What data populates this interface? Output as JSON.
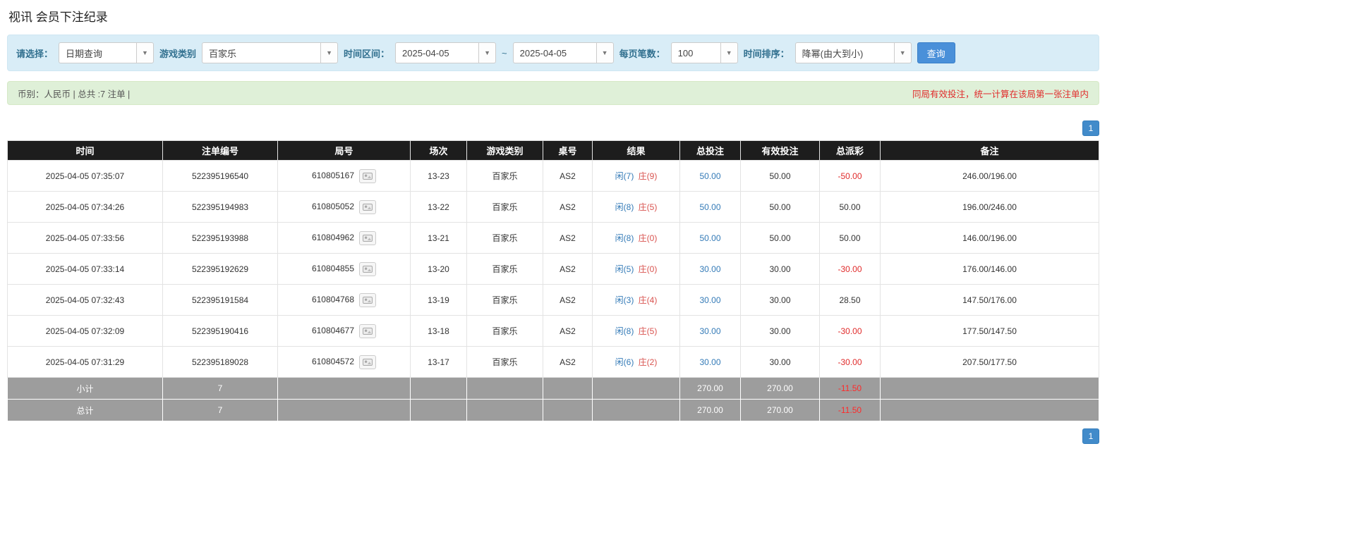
{
  "page": {
    "title": "视讯 会员下注纪录"
  },
  "filters": {
    "select_label": "请选择：",
    "select_value": "日期查询",
    "game_type_label": "游戏类别",
    "game_type_value": "百家乐",
    "time_range_label": "时间区间：",
    "date_from": "2025-04-05",
    "range_separator": "~",
    "date_to": "2025-04-05",
    "page_size_label": "每页笔数：",
    "page_size_value": "100",
    "sort_label": "时间排序：",
    "sort_value": "降幂(由大到小)",
    "search_button": "查询"
  },
  "summary": {
    "left": "币别：人民币 | 总共 :7 注单 |",
    "right": "同局有效投注，统一计算在该局第一张注单内"
  },
  "pagination": {
    "page": "1"
  },
  "table": {
    "headers": [
      "时间",
      "注单编号",
      "局号",
      "场次",
      "游戏类别",
      "桌号",
      "结果",
      "总投注",
      "有效投注",
      "总派彩",
      "备注"
    ],
    "rows": [
      {
        "time": "2025-04-05 07:35:07",
        "bet_id": "522395196540",
        "round_id": "610805167",
        "session": "13-23",
        "game": "百家乐",
        "table_no": "AS2",
        "result_player": "闲(7)",
        "result_banker": "庄(9)",
        "total_bet": "50.00",
        "valid_bet": "50.00",
        "payout": "-50.00",
        "remark": "246.00/196.00"
      },
      {
        "time": "2025-04-05 07:34:26",
        "bet_id": "522395194983",
        "round_id": "610805052",
        "session": "13-22",
        "game": "百家乐",
        "table_no": "AS2",
        "result_player": "闲(8)",
        "result_banker": "庄(5)",
        "total_bet": "50.00",
        "valid_bet": "50.00",
        "payout": "50.00",
        "remark": "196.00/246.00"
      },
      {
        "time": "2025-04-05 07:33:56",
        "bet_id": "522395193988",
        "round_id": "610804962",
        "session": "13-21",
        "game": "百家乐",
        "table_no": "AS2",
        "result_player": "闲(8)",
        "result_banker": "庄(0)",
        "total_bet": "50.00",
        "valid_bet": "50.00",
        "payout": "50.00",
        "remark": "146.00/196.00"
      },
      {
        "time": "2025-04-05 07:33:14",
        "bet_id": "522395192629",
        "round_id": "610804855",
        "session": "13-20",
        "game": "百家乐",
        "table_no": "AS2",
        "result_player": "闲(5)",
        "result_banker": "庄(0)",
        "total_bet": "30.00",
        "valid_bet": "30.00",
        "payout": "-30.00",
        "remark": "176.00/146.00"
      },
      {
        "time": "2025-04-05 07:32:43",
        "bet_id": "522395191584",
        "round_id": "610804768",
        "session": "13-19",
        "game": "百家乐",
        "table_no": "AS2",
        "result_player": "闲(3)",
        "result_banker": "庄(4)",
        "total_bet": "30.00",
        "valid_bet": "30.00",
        "payout": "28.50",
        "remark": "147.50/176.00"
      },
      {
        "time": "2025-04-05 07:32:09",
        "bet_id": "522395190416",
        "round_id": "610804677",
        "session": "13-18",
        "game": "百家乐",
        "table_no": "AS2",
        "result_player": "闲(8)",
        "result_banker": "庄(5)",
        "total_bet": "30.00",
        "valid_bet": "30.00",
        "payout": "-30.00",
        "remark": "177.50/147.50"
      },
      {
        "time": "2025-04-05 07:31:29",
        "bet_id": "522395189028",
        "round_id": "610804572",
        "session": "13-17",
        "game": "百家乐",
        "table_no": "AS2",
        "result_player": "闲(6)",
        "result_banker": "庄(2)",
        "total_bet": "30.00",
        "valid_bet": "30.00",
        "payout": "-30.00",
        "remark": "207.50/177.50"
      }
    ],
    "subtotal": {
      "label": "小计",
      "count": "7",
      "total_bet": "270.00",
      "valid_bet": "270.00",
      "payout": "-11.50"
    },
    "total": {
      "label": "总计",
      "count": "7",
      "total_bet": "270.00",
      "valid_bet": "270.00",
      "payout": "-11.50"
    }
  }
}
